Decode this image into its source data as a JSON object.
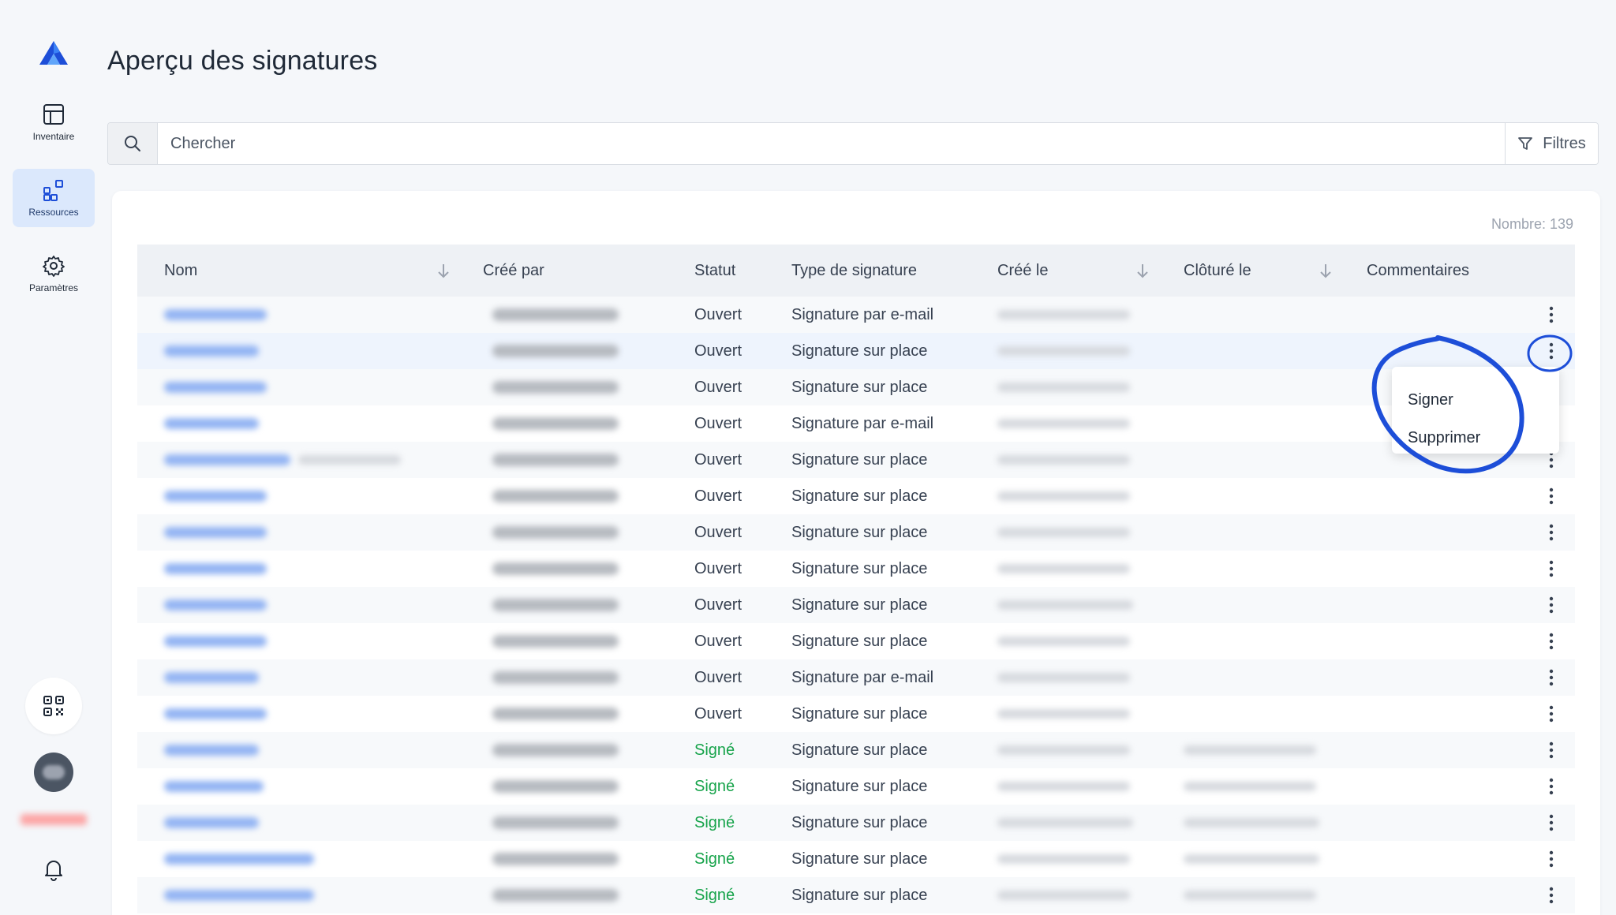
{
  "nav": {
    "items": [
      {
        "label": "Inventaire",
        "icon": "table-icon"
      },
      {
        "label": "Ressources",
        "icon": "widgets-icon"
      },
      {
        "label": "Paramètres",
        "icon": "gear-icon"
      }
    ],
    "active": "Ressources"
  },
  "header": {
    "title": "Aperçu des signatures"
  },
  "search": {
    "placeholder": "Chercher",
    "value": ""
  },
  "filters": {
    "label": "Filtres"
  },
  "table": {
    "count_label": "Nombre: 139",
    "columns": [
      "Nom",
      "Créé par",
      "Statut",
      "Type de signature",
      "Créé le",
      "Clôturé le",
      "Commentaires"
    ],
    "sortable_columns": [
      "Nom",
      "Créé le",
      "Clôturé le"
    ],
    "rows": [
      {
        "status": "Ouvert",
        "type": "Signature par e-mail"
      },
      {
        "status": "Ouvert",
        "type": "Signature sur place"
      },
      {
        "status": "Ouvert",
        "type": "Signature sur place"
      },
      {
        "status": "Ouvert",
        "type": "Signature par e-mail"
      },
      {
        "status": "Ouvert",
        "type": "Signature sur place"
      },
      {
        "status": "Ouvert",
        "type": "Signature sur place"
      },
      {
        "status": "Ouvert",
        "type": "Signature sur place"
      },
      {
        "status": "Ouvert",
        "type": "Signature sur place"
      },
      {
        "status": "Ouvert",
        "type": "Signature sur place"
      },
      {
        "status": "Ouvert",
        "type": "Signature sur place"
      },
      {
        "status": "Ouvert",
        "type": "Signature par e-mail"
      },
      {
        "status": "Ouvert",
        "type": "Signature sur place"
      },
      {
        "status": "Signé",
        "type": "Signature sur place"
      },
      {
        "status": "Signé",
        "type": "Signature sur place"
      },
      {
        "status": "Signé",
        "type": "Signature sur place"
      },
      {
        "status": "Signé",
        "type": "Signature sur place"
      },
      {
        "status": "Signé",
        "type": "Signature sur place"
      }
    ]
  },
  "row_menu": {
    "items": [
      "Signer",
      "Supprimer"
    ]
  },
  "colors": {
    "accent": "#2563eb",
    "signed": "#16a34a",
    "annotation": "#1d4ed8",
    "active_nav_bg": "#dbe8fc"
  }
}
